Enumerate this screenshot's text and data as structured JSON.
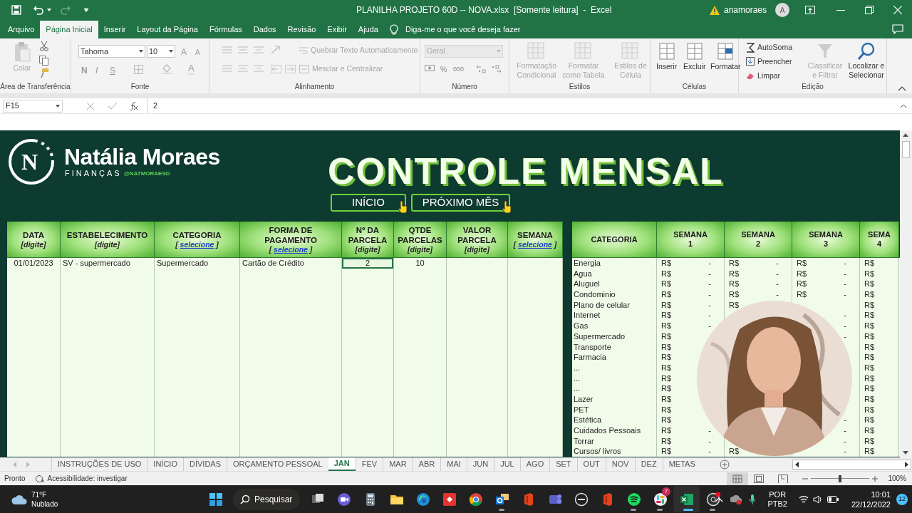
{
  "window": {
    "title": "PLANILHA PROJETO 60D -- NOVA.xlsx  [Somente leitura]  -  Excel",
    "user": "anamoraes",
    "avatar": "A"
  },
  "menu": {
    "tabs": [
      {
        "label": "Arquivo",
        "selected": false
      },
      {
        "label": "Página Inicial",
        "selected": true
      },
      {
        "label": "Inserir",
        "selected": false
      },
      {
        "label": "Layout da Página",
        "selected": false
      },
      {
        "label": "Fórmulas",
        "selected": false
      },
      {
        "label": "Dados",
        "selected": false
      },
      {
        "label": "Revisão",
        "selected": false
      },
      {
        "label": "Exibir",
        "selected": false
      },
      {
        "label": "Ajuda",
        "selected": false
      }
    ],
    "tell_me": "Diga-me o que você deseja fazer"
  },
  "ribbon": {
    "groups": [
      {
        "kind": "clipboard",
        "label": "Área de Transferência",
        "paste": {
          "label": "Colar",
          "disabled": true
        }
      },
      {
        "kind": "font",
        "label": "Fonte",
        "font": "Tahoma",
        "size": "10",
        "grow": "A",
        "shrink": "A",
        "styles": [
          "N",
          "I",
          "S"
        ],
        "color_letter": "A"
      },
      {
        "kind": "alignment",
        "label": "Alinhamento",
        "wrap": {
          "label": "Quebrar Texto Automaticamente",
          "disabled": true
        },
        "merge": {
          "label": "Mesclar e Centralizar",
          "disabled": true
        }
      },
      {
        "kind": "number",
        "label": "Número",
        "format": {
          "label": "Geral",
          "disabled": true
        },
        "percent": "%",
        "thousands": "000"
      },
      {
        "kind": "styles",
        "label": "Estilos",
        "buttons": [
          {
            "label": "Formatação Condicional",
            "disabled": true
          },
          {
            "label": "Formatar como Tabela",
            "disabled": true
          },
          {
            "label": "Estilos de Célula",
            "disabled": true
          }
        ]
      },
      {
        "kind": "cells",
        "label": "Células",
        "buttons": [
          "Inserir",
          "Excluir",
          "Formatar"
        ]
      },
      {
        "kind": "editing",
        "label": "Edição",
        "items": [
          "AutoSoma",
          "Preencher",
          "Limpar"
        ],
        "sort": {
          "label": "Classificar e Filtrar",
          "disabled": true
        },
        "find": "Localizar e Selecionar"
      }
    ]
  },
  "formula_bar": {
    "name_box": "F15",
    "value": "2"
  },
  "sheet": {
    "brand": {
      "name": "Natália Moraes",
      "subtitle": "FINANÇAS",
      "handle": "@NATMORAESD",
      "logo_letter": "N"
    },
    "title": "CONTROLE MENSAL",
    "nav_buttons": [
      "INÍCIO",
      "PRÓXIMO MÊS"
    ],
    "entries": {
      "columns": [
        {
          "lines": [
            "DATA"
          ],
          "hint": [
            "[digite]"
          ],
          "kind": "input"
        },
        {
          "lines": [
            "ESTABELECIMENTO"
          ],
          "hint": [
            "[digite]"
          ],
          "kind": "input"
        },
        {
          "lines": [
            "CATEGORIA"
          ],
          "hint": [
            "[ ",
            "selecione",
            " ]"
          ],
          "kind": "select"
        },
        {
          "lines": [
            "FORMA DE",
            "PAGAMENTO"
          ],
          "hint": [
            "[ ",
            "selecione",
            " ]"
          ],
          "kind": "select"
        },
        {
          "lines": [
            "Nº DA",
            "PARCELA"
          ],
          "hint": [
            "[digite]"
          ],
          "kind": "input"
        },
        {
          "lines": [
            "QTDE",
            "PARCELAS"
          ],
          "hint": [
            "[digite]"
          ],
          "kind": "input"
        },
        {
          "lines": [
            "VALOR",
            "PARCELA"
          ],
          "hint": [
            "[digite]"
          ],
          "kind": "input"
        },
        {
          "lines": [
            "SEMANA"
          ],
          "hint": [
            "[ ",
            "selecione",
            " ]"
          ],
          "kind": "select"
        }
      ],
      "rows": [
        {
          "cells": [
            {
              "text": "01/01/2023",
              "selected": false
            },
            {
              "text": "SV - supermercado",
              "selected": false
            },
            {
              "text": "Supermercado",
              "selected": false
            },
            {
              "text": "Cartão de Crédito",
              "selected": false
            },
            {
              "text": "2",
              "selected": true
            },
            {
              "text": "10",
              "selected": false
            },
            {
              "selected": false
            },
            {
              "selected": false
            }
          ]
        }
      ]
    },
    "budget": {
      "category_header": "CATEGORIA",
      "week_headers": [
        [
          "SEMANA",
          "1"
        ],
        [
          "SEMANA",
          "2"
        ],
        [
          "SEMANA",
          "3"
        ],
        [
          "SEMA",
          "4"
        ]
      ],
      "rows": [
        {
          "category": "Energia",
          "week_1": {
            "currency": "R$",
            "amount": "-"
          },
          "week_2": {
            "currency": "R$",
            "amount": "-"
          },
          "week_3": {
            "currency": "R$",
            "amount": "-"
          },
          "week_4": {
            "currency": "R$"
          }
        },
        {
          "category": "Agua",
          "week_1": {
            "currency": "R$",
            "amount": "-"
          },
          "week_2": {
            "currency": "R$",
            "amount": "-"
          },
          "week_3": {
            "currency": "R$",
            "amount": "-"
          },
          "week_4": {
            "currency": "R$"
          }
        },
        {
          "category": "Aluguel",
          "week_1": {
            "currency": "R$",
            "amount": "-"
          },
          "week_2": {
            "currency": "R$",
            "amount": "-"
          },
          "week_3": {
            "currency": "R$",
            "amount": "-"
          },
          "week_4": {
            "currency": "R$"
          }
        },
        {
          "category": "Condominio",
          "week_1": {
            "currency": "R$",
            "amount": "-"
          },
          "week_2": {
            "currency": "R$",
            "amount": "-"
          },
          "week_3": {
            "currency": "R$",
            "amount": "-"
          },
          "week_4": {
            "currency": "R$"
          }
        },
        {
          "category": "Plano de celular",
          "week_1": {
            "currency": "R$",
            "amount": "-"
          },
          "week_2": {
            "currency": "R$"
          },
          "week_4": {
            "currency": "R$"
          }
        },
        {
          "category": "Internet",
          "week_1": {
            "currency": "R$",
            "amount": "-"
          },
          "week_3": {
            "amount": "-"
          },
          "week_4": {
            "currency": "R$"
          }
        },
        {
          "category": "Gas",
          "week_1": {
            "currency": "R$",
            "amount": "-"
          },
          "week_3": {
            "amount": "-"
          },
          "week_4": {
            "currency": "R$"
          }
        },
        {
          "category": "Supermercado",
          "week_1": {
            "currency": "R$"
          },
          "week_3": {
            "amount": "-"
          },
          "week_4": {
            "currency": "R$"
          }
        },
        {
          "category": "Transporte",
          "week_1": {
            "currency": "R$"
          },
          "week_4": {
            "currency": "R$"
          }
        },
        {
          "category": "Farmacia",
          "week_1": {
            "currency": "R$"
          },
          "week_4": {
            "currency": "R$"
          }
        },
        {
          "category": "...",
          "week_1": {
            "currency": "R$"
          },
          "week_4": {
            "currency": "R$"
          }
        },
        {
          "category": "...",
          "week_1": {
            "currency": "R$"
          },
          "week_4": {
            "currency": "R$"
          }
        },
        {
          "category": "...",
          "week_1": {
            "currency": "R$"
          },
          "week_4": {
            "currency": "R$"
          }
        },
        {
          "category": "Lazer",
          "week_1": {
            "currency": "R$"
          },
          "week_4": {
            "currency": "R$"
          }
        },
        {
          "category": "PET",
          "week_1": {
            "currency": "R$"
          },
          "week_4": {
            "currency": "R$"
          }
        },
        {
          "category": "Estética",
          "week_1": {
            "currency": "R$"
          },
          "week_3": {
            "amount": "-"
          },
          "week_4": {
            "currency": "R$"
          }
        },
        {
          "category": "Cuidados Pessoais",
          "week_1": {
            "currency": "R$",
            "amount": "-"
          },
          "week_3": {
            "amount": "-"
          },
          "week_4": {
            "currency": "R$"
          }
        },
        {
          "category": "Torrar",
          "week_1": {
            "currency": "R$",
            "amount": "-"
          },
          "week_3": {
            "amount": "-"
          },
          "week_4": {
            "currency": "R$"
          }
        },
        {
          "category": "Cursos/ livros",
          "week_1": {
            "currency": "R$",
            "amount": "-"
          },
          "week_2": {
            "currency": "R$"
          },
          "week_3": {
            "amount": "-"
          },
          "week_4": {
            "currency": "R$"
          }
        }
      ]
    },
    "video": {
      "kind": "picture"
    }
  },
  "sheet_tabs": [
    {
      "label": "INSTRUÇÕES DE USO",
      "selected": false
    },
    {
      "label": "INÍCIO",
      "selected": false
    },
    {
      "label": "DÍVIDAS",
      "selected": false
    },
    {
      "label": "ORÇAMENTO PESSOAL",
      "selected": false
    },
    {
      "label": "JAN",
      "selected": true
    },
    {
      "label": "FEV",
      "selected": false
    },
    {
      "label": "MAR",
      "selected": false
    },
    {
      "label": "ABR",
      "selected": false
    },
    {
      "label": "MAI",
      "selected": false
    },
    {
      "label": "JUN",
      "selected": false
    },
    {
      "label": "JUL",
      "selected": false
    },
    {
      "label": "AGO",
      "selected": false
    },
    {
      "label": "SET",
      "selected": false
    },
    {
      "label": "OUT",
      "selected": false
    },
    {
      "label": "NOV",
      "selected": false
    },
    {
      "label": "DEZ",
      "selected": false
    },
    {
      "label": "METAS",
      "selected": false
    }
  ],
  "status_bar": {
    "state": "Pronto",
    "accessibility": "Acessibilidade: investigar",
    "zoom": "100%",
    "zoom_slider": {
      "level": 0.5
    }
  },
  "taskbar": {
    "weather": {
      "temp": "71°F",
      "condition": "Nublado"
    },
    "search": "Pesquisar",
    "apps": [
      {
        "kind": "start",
        "running": false
      },
      {
        "kind": "search"
      },
      {
        "kind": "taskview",
        "running": false
      },
      {
        "kind": "meet",
        "running": false
      },
      {
        "kind": "calc",
        "running": false
      },
      {
        "kind": "folder",
        "running": false
      },
      {
        "kind": "edge",
        "running": false
      },
      {
        "kind": "remote",
        "running": false
      },
      {
        "kind": "chrome",
        "running": false
      },
      {
        "kind": "mail",
        "running": true
      },
      {
        "kind": "office",
        "running": false
      },
      {
        "kind": "teams",
        "running": false
      },
      {
        "kind": "dell",
        "running": false
      },
      {
        "kind": "office",
        "running": false
      },
      {
        "kind": "music",
        "running": true
      },
      {
        "kind": "chat",
        "running": true,
        "badge": "7"
      },
      {
        "kind": "sheet",
        "running": true
      },
      {
        "kind": "record",
        "running": true
      }
    ],
    "tray": {
      "lang": "POR",
      "layout": "PTB2",
      "time": "10:01",
      "date": "22/12/2022",
      "notifications": "12"
    }
  }
}
